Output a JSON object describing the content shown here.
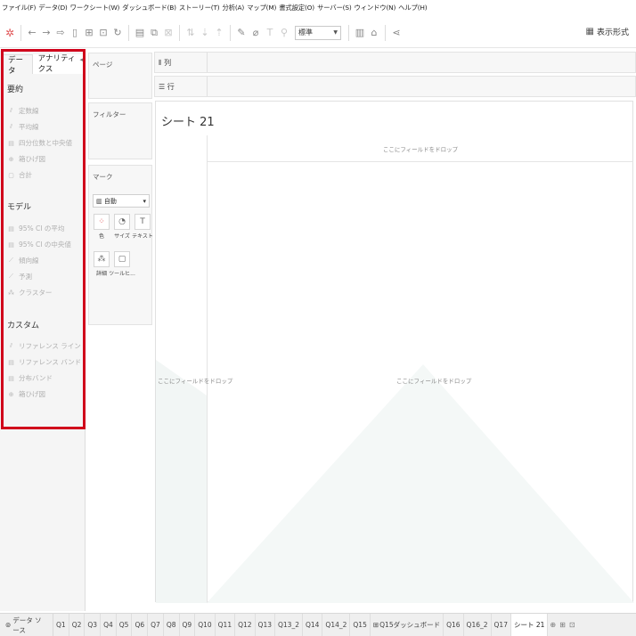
{
  "menu": [
    "ファイル(F)",
    "データ(D)",
    "ワークシート(W)",
    "ダッシュボード(B)",
    "ストーリー(T)",
    "分析(A)",
    "マップ(M)",
    "書式設定(O)",
    "サーバー(S)",
    "ウィンドウ(N)",
    "ヘルプ(H)"
  ],
  "toolbar": {
    "fit_value": "標準",
    "show_me": "表示形式"
  },
  "left_panel": {
    "tabs": {
      "data": "データ",
      "analytics": "アナリティクス"
    },
    "sections": [
      {
        "title": "要約",
        "items": [
          {
            "icon": "reference-line-icon",
            "glyph": "⫽",
            "label": "定数線"
          },
          {
            "icon": "reference-line-icon",
            "glyph": "⫽",
            "label": "平均線"
          },
          {
            "icon": "box-plot-icon",
            "glyph": "▤",
            "label": "四分位数と中央値"
          },
          {
            "icon": "box-whisker-icon",
            "glyph": "⊕",
            "label": "箱ひげ図"
          },
          {
            "icon": "totals-icon",
            "glyph": "▢",
            "label": "合計"
          }
        ]
      },
      {
        "title": "モデル",
        "items": [
          {
            "icon": "ci-icon",
            "glyph": "▤",
            "label": "95% CI の平均"
          },
          {
            "icon": "ci-icon",
            "glyph": "▤",
            "label": "95% CI の中央値"
          },
          {
            "icon": "trend-line-icon",
            "glyph": "⟋",
            "label": "傾向線"
          },
          {
            "icon": "forecast-icon",
            "glyph": "⟋",
            "label": "予測"
          },
          {
            "icon": "cluster-icon",
            "glyph": "⁂",
            "label": "クラスター"
          }
        ]
      },
      {
        "title": "カスタム",
        "items": [
          {
            "icon": "reference-line-icon",
            "glyph": "⫽",
            "label": "リファレンス ライン"
          },
          {
            "icon": "reference-band-icon",
            "glyph": "▤",
            "label": "リファレンス バンド"
          },
          {
            "icon": "distribution-band-icon",
            "glyph": "▤",
            "label": "分布バンド"
          },
          {
            "icon": "box-whisker-icon",
            "glyph": "⊕",
            "label": "箱ひげ図"
          }
        ]
      }
    ]
  },
  "shelves": {
    "pages": "ページ",
    "filters": "フィルター",
    "marks": {
      "title": "マーク",
      "type": "自動",
      "buttons": [
        {
          "name": "color",
          "glyph": "⁘",
          "label": "色"
        },
        {
          "name": "size",
          "glyph": "◔",
          "label": "サイズ"
        },
        {
          "name": "text",
          "glyph": "T",
          "label": "テキスト"
        },
        {
          "name": "detail",
          "glyph": "⁂",
          "label": "詳細"
        },
        {
          "name": "tooltip",
          "glyph": "▢",
          "label": "ツールヒ..."
        }
      ]
    },
    "columns": "列",
    "rows": "行"
  },
  "sheet": {
    "title": "シート 21",
    "drop_top": "ここにフィールドをドロップ",
    "drop_left": "ここにフィールドをドロップ",
    "drop_center": "ここにフィールドをドロップ"
  },
  "bottom": {
    "data_source": "データ ソース",
    "sheets": [
      "Q1",
      "Q2",
      "Q3",
      "Q4",
      "Q5",
      "Q6",
      "Q7",
      "Q8",
      "Q9",
      "Q10",
      "Q11",
      "Q12",
      "Q13",
      "Q13_2",
      "Q14",
      "Q14_2",
      "Q15",
      "Q15ダッシュボード",
      "Q16",
      "Q16_2",
      "Q17",
      "シート 21"
    ],
    "active_sheet": "シート 21"
  },
  "colors": {
    "highlight": "#d0021b",
    "accent": "#e15759"
  }
}
